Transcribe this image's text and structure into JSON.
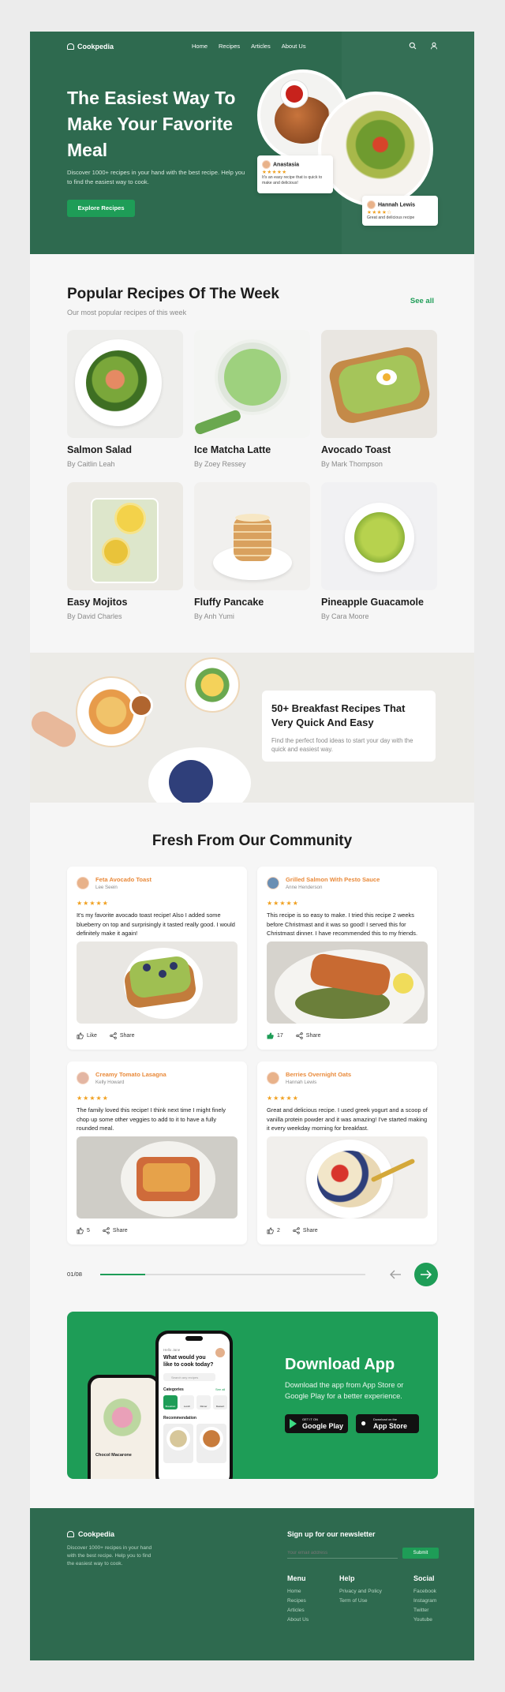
{
  "nav": {
    "brand": "Cookpedia",
    "links": [
      "Home",
      "Recipes",
      "Articles",
      "About Us"
    ]
  },
  "hero": {
    "title": "The Easiest Way To Make Your Favorite Meal",
    "subtitle": "Discover 1000+ recipes in your hand with the best recipe. Help you to find the easiest way to cook.",
    "cta": "Explore Recipes",
    "reviews": [
      {
        "name": "Anastasia",
        "stars": "★★★★★",
        "text": "It's an easy recipe that is quick to make and delicious!"
      },
      {
        "name": "Hannah Lewis",
        "stars": "★★★★☆",
        "text": "Great and delicious recipe"
      }
    ]
  },
  "popular": {
    "title": "Popular Recipes Of The Week",
    "subtitle": "Our most popular recipes of this week",
    "see_all": "See all",
    "items": [
      {
        "title": "Salmon Salad",
        "author": "By Caitlin Leah"
      },
      {
        "title": "Ice Matcha Latte",
        "author": "By Zoey Ressey"
      },
      {
        "title": "Avocado Toast",
        "author": "By Mark Thompson"
      },
      {
        "title": "Easy Mojitos",
        "author": "By David Charles"
      },
      {
        "title": "Fluffy Pancake",
        "author": "By Anh Yumi"
      },
      {
        "title": "Pineapple Guacamole",
        "author": "By Cara Moore"
      }
    ]
  },
  "banner": {
    "title": "50+ Breakfast Recipes That Very Quick And Easy",
    "subtitle": "Find the perfect food ideas to start your day with the quick and easiest way."
  },
  "community": {
    "title": "Fresh From Our Community",
    "posts": [
      {
        "recipe": "Feta Avocado Toast",
        "user": "Lee Seein",
        "stars": "★★★★★",
        "text": "It's my favorite avocado toast recipe! Also I added some blueberry on top and surprisingly it tasted really good. I would definitely make it again!",
        "like": "Like",
        "share": "Share"
      },
      {
        "recipe": "Grilled Salmon With Pesto Sauce",
        "user": "Anne Henderson",
        "stars": "★★★★★",
        "text": "This recipe is so easy to make. I tried this recipe 2 weeks before Christmast and it was so good! I served this for Christmast dinner. I have recommended this to my friends.",
        "like": "17",
        "share": "Share"
      },
      {
        "recipe": "Creamy Tomato Lasagna",
        "user": "Kelly Howard",
        "stars": "★★★★★",
        "text": "The family loved this recipe! I think next time I might finely chop up some other veggies to add to it to have a fully rounded meal.",
        "like": "5",
        "share": "Share"
      },
      {
        "recipe": "Berries Overnight Oats",
        "user": "Hannah Lewis",
        "stars": "★★★★★",
        "text": "Great and delicious recipe. I used greek yogurt and a scoop of vanilla protein powder and it was amazing! I've started making it every weekday morning for breakfast.",
        "like": "2",
        "share": "Share"
      }
    ],
    "pager": "01/08",
    "progress": 0.17
  },
  "download": {
    "title": "Download App",
    "subtitle": "Download the app from App Store or Google Play for a better experience.",
    "google_small": "GET IT ON",
    "google": "Google Play",
    "apple_small": "Download on the",
    "apple": "App Store",
    "phone": {
      "greeting": "Hello Jane",
      "question": "What would you like to cook today?",
      "search": "Search any recipes",
      "categories": "Categories",
      "see_all": "See all",
      "cats": [
        "Breakfast",
        "Lunch",
        "Dinner",
        "Dessert"
      ],
      "recommendation": "Recommendation",
      "card": "Chocol Macarone"
    }
  },
  "footer": {
    "brand": "Cookpedia",
    "desc": "Discover 1000+ recipes in your hand with the best recipe. Help you to find the easiest way to cook.",
    "newsletter": "Sign up for our newsletter",
    "email_placeholder": "Your email address",
    "submit": "Submit",
    "menu_title": "Menu",
    "menu": [
      "Home",
      "Recipes",
      "Articles",
      "About Us"
    ],
    "help_title": "Help",
    "help": [
      "Privacy and Policy",
      "Term of Use"
    ],
    "social_title": "Social",
    "social": [
      "Facebook",
      "Instagram",
      "Twitter",
      "Youtube"
    ]
  }
}
